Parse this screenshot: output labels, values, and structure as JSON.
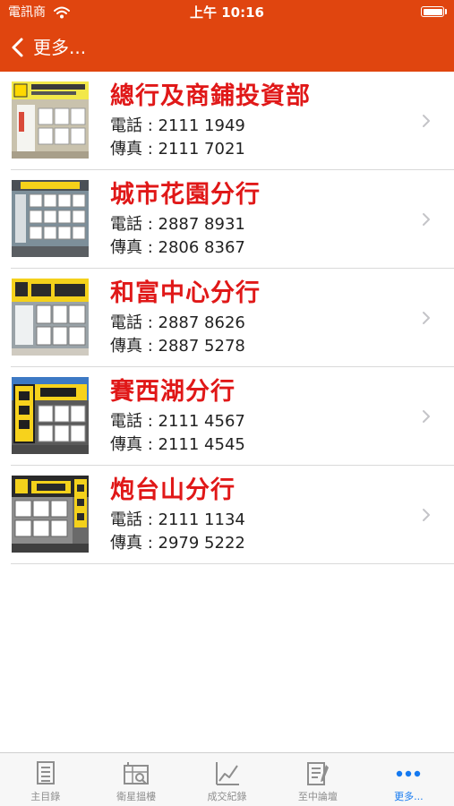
{
  "status_bar": {
    "carrier": "電訊商",
    "time": "上午 10:16"
  },
  "nav": {
    "back_label": "更多..."
  },
  "branches": [
    {
      "name": "總行及商鋪投資部",
      "tel": "電話 : 2111 1949",
      "fax": "傳真 : 2111 7021"
    },
    {
      "name": "城市花園分行",
      "tel": "電話 : 2887 8931",
      "fax": "傳真 : 2806 8367"
    },
    {
      "name": "和富中心分行",
      "tel": "電話 : 2887 8626",
      "fax": "傳真 : 2887 5278"
    },
    {
      "name": "賽西湖分行",
      "tel": "電話 : 2111 4567",
      "fax": "傳真 : 2111 4545"
    },
    {
      "name": "炮台山分行",
      "tel": "電話 : 2111 1134",
      "fax": "傳真 : 2979 5222"
    }
  ],
  "tabs": [
    {
      "label": "主目錄",
      "icon": "list-icon",
      "active": false
    },
    {
      "label": "衛星搵樓",
      "icon": "satellite-map-icon",
      "active": false
    },
    {
      "label": "成交紀錄",
      "icon": "line-chart-icon",
      "active": false
    },
    {
      "label": "至中論壇",
      "icon": "forum-notes-icon",
      "active": false
    },
    {
      "label": "更多...",
      "icon": "more-dots-icon",
      "active": true
    }
  ],
  "colors": {
    "header": "#e0450f",
    "branch_name": "#e01818",
    "tab_active": "#1479f0",
    "tab_inactive": "#8e8e8e"
  }
}
